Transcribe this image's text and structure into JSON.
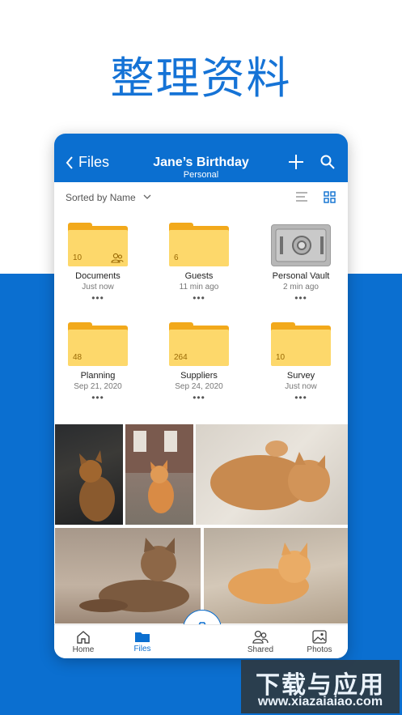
{
  "headline": "整理资料",
  "appbar": {
    "back_label": "Files",
    "title": "Jane’s Birthday",
    "subtitle": "Personal"
  },
  "sortbar": {
    "label": "Sorted by Name"
  },
  "tiles": [
    {
      "name": "Documents",
      "meta": "Just now",
      "count": "10",
      "type": "shared-folder"
    },
    {
      "name": "Guests",
      "meta": "11 min ago",
      "count": "6",
      "type": "folder"
    },
    {
      "name": "Personal Vault",
      "meta": "2 min ago",
      "count": "",
      "type": "vault"
    },
    {
      "name": "Planning",
      "meta": "Sep 21, 2020",
      "count": "48",
      "type": "folder"
    },
    {
      "name": "Suppliers",
      "meta": "Sep 24, 2020",
      "count": "264",
      "type": "folder"
    },
    {
      "name": "Survey",
      "meta": "Just now",
      "count": "10",
      "type": "folder"
    }
  ],
  "more_glyph": "•••",
  "nav": {
    "home": "Home",
    "files": "Files",
    "shared": "Shared",
    "photos": "Photos"
  },
  "watermark": {
    "line1": "下载与应用",
    "line2": "www.xiazaiaiao.com"
  },
  "colors": {
    "brand_blue": "#0b6fd0",
    "folder_yellow": "#fdd86b",
    "folder_dark": "#f2a91b"
  }
}
